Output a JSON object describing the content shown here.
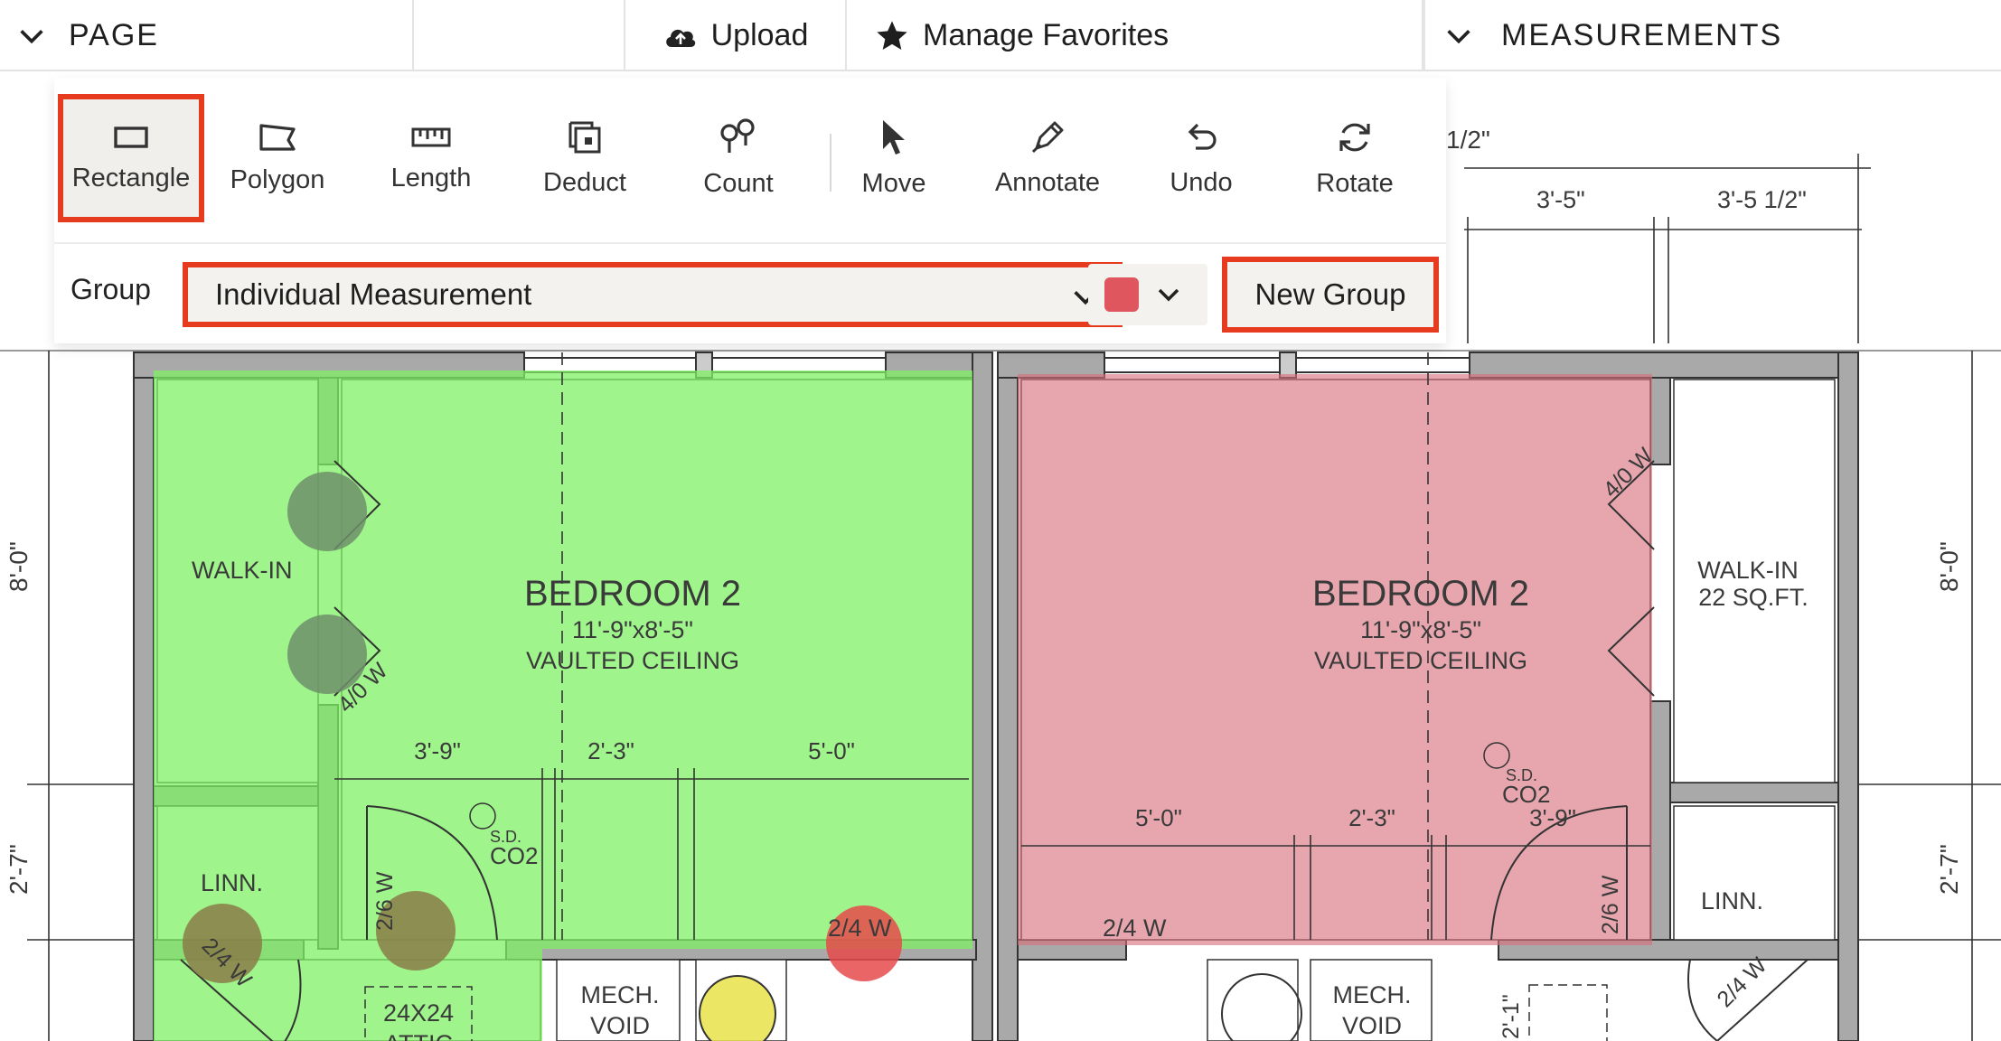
{
  "header": {
    "page_label": "PAGE",
    "upload_label": "Upload",
    "favorites_label": "Manage Favorites",
    "measurements_label": "MEASUREMENTS"
  },
  "toolbar": {
    "tools": [
      {
        "label": "Rectangle",
        "icon": "rectangle-icon",
        "selected": true
      },
      {
        "label": "Polygon",
        "icon": "polygon-icon"
      },
      {
        "label": "Length",
        "icon": "ruler-icon"
      },
      {
        "label": "Deduct",
        "icon": "deduct-icon"
      },
      {
        "label": "Count",
        "icon": "count-icon"
      },
      {
        "label": "Move",
        "icon": "cursor-icon"
      },
      {
        "label": "Annotate",
        "icon": "pen-icon"
      },
      {
        "label": "Undo",
        "icon": "undo-icon"
      },
      {
        "label": "Rotate",
        "icon": "rotate-icon"
      }
    ]
  },
  "group": {
    "label": "Group",
    "selected": "Individual Measurement",
    "color": "#e0565f",
    "new_group_label": "New Group"
  },
  "colors": {
    "highlight_border": "#e63b1f",
    "green_fill": "#8ff57a",
    "red_fill": "#e08a92"
  },
  "plan": {
    "top_dims": {
      "partial": "1/2\"",
      "left": "3'-5\"",
      "right": "3'-5 1/2\""
    },
    "side_dims": {
      "upper": "8'-0\"",
      "lower": "2'-7\""
    },
    "left": {
      "room_name": "BEDROOM 2",
      "room_size": "11'-9\"x8'-5\"",
      "room_ceiling": "VAULTED CEILING",
      "walkin": "WALK-IN",
      "door_top": "4/0 W",
      "dim_a": "3'-9\"",
      "dim_b": "2'-3\"",
      "dim_c": "5'-0\"",
      "sd": "S.D.",
      "co2": "CO2",
      "linn": "LINN.",
      "door_linn": "2/4 W",
      "door_closet": "2/6 W",
      "door_mech": "2/4 W",
      "mech1": "MECH.",
      "mech2": "VOID",
      "attic1": "24X24",
      "attic2": "ATTIC"
    },
    "right": {
      "room_name": "BEDROOM 2",
      "room_size": "11'-9\"x8'-5\"",
      "room_ceiling": "VAULTED CEILING",
      "walkin1": "WALK-IN",
      "walkin2": "22 SQ.FT.",
      "door_top": "4/0 W",
      "dim_a": "5'-0\"",
      "dim_b": "2'-3\"",
      "dim_c": "3'-9\"",
      "sd": "S.D.",
      "co2": "CO2",
      "linn": "LINN.",
      "door_closet": "2/6 W",
      "door_linn": "2/4 W",
      "door_bottom": "2/4 W",
      "mech1": "MECH.",
      "mech2": "VOID",
      "stair_dim": "2'-1\""
    }
  }
}
